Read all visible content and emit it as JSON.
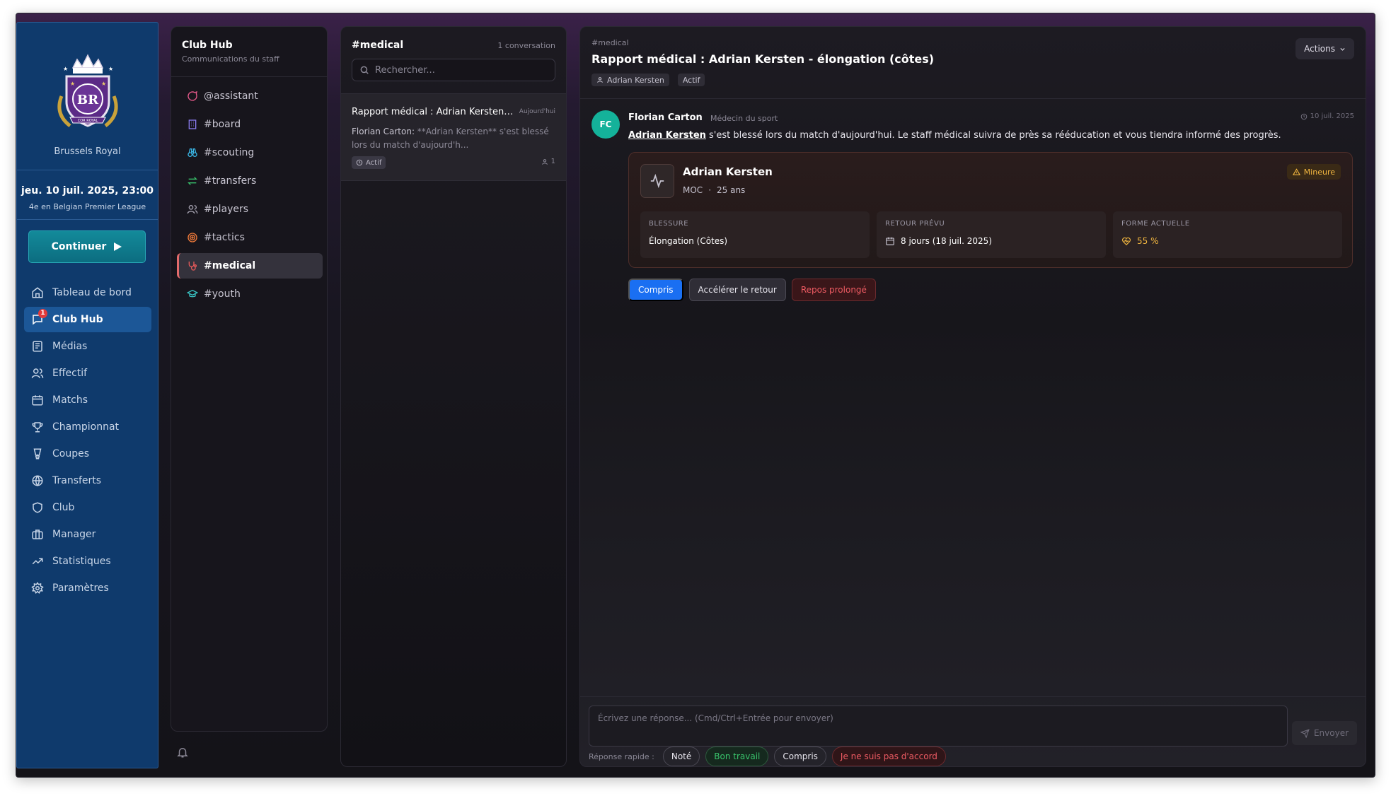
{
  "sidebar": {
    "club_name": "Brussels Royal",
    "crest_text": "BR",
    "crest_banner": "COR ROYAL",
    "date": "jeu. 10 juil. 2025, 23:00",
    "league_position": "4e en Belgian Premier League",
    "continue_label": "Continuer",
    "items": [
      {
        "label": "Tableau de bord",
        "icon": "home-icon"
      },
      {
        "label": "Club Hub",
        "icon": "chat-icon",
        "badge": "1",
        "active": true
      },
      {
        "label": "Médias",
        "icon": "newspaper-icon"
      },
      {
        "label": "Effectif",
        "icon": "users-icon"
      },
      {
        "label": "Matchs",
        "icon": "calendar-icon"
      },
      {
        "label": "Championnat",
        "icon": "trophy-icon"
      },
      {
        "label": "Coupes",
        "icon": "cup-icon"
      },
      {
        "label": "Transferts",
        "icon": "globe-icon"
      },
      {
        "label": "Club",
        "icon": "shield-icon"
      },
      {
        "label": "Manager",
        "icon": "briefcase-icon"
      },
      {
        "label": "Statistiques",
        "icon": "trending-icon"
      },
      {
        "label": "Paramètres",
        "icon": "gear-icon"
      }
    ]
  },
  "channels": {
    "title": "Club Hub",
    "subtitle": "Communications du staff",
    "items": [
      {
        "label": "@assistant",
        "icon": "message-circle-icon",
        "color": "#e85a8c"
      },
      {
        "label": "#board",
        "icon": "building-icon",
        "color": "#8b7cf0"
      },
      {
        "label": "#scouting",
        "icon": "binoculars-icon",
        "color": "#3ab7e6"
      },
      {
        "label": "#transfers",
        "icon": "arrows-swap-icon",
        "color": "#39c46c"
      },
      {
        "label": "#players",
        "icon": "users-icon",
        "color": "#a8a5b3"
      },
      {
        "label": "#tactics",
        "icon": "target-icon",
        "color": "#f07a3a"
      },
      {
        "label": "#medical",
        "icon": "stethoscope-icon",
        "color": "#e85a5a",
        "active": true
      },
      {
        "label": "#youth",
        "icon": "graduation-cap-icon",
        "color": "#39c4c4"
      }
    ]
  },
  "conversations": {
    "channel": "#medical",
    "count": "1 conversation",
    "search_placeholder": "Rechercher...",
    "items": [
      {
        "title": "Rapport médical : Adrian Kersten - élongation (côtes)",
        "time": "Aujourd'hui",
        "preview_sender": "Florian Carton:",
        "preview_text": " **Adrian Kersten** s'est blessé lors du match d'aujourd'h...",
        "status": "Actif",
        "participants": "1"
      }
    ]
  },
  "thread": {
    "channel": "#medical",
    "title": "Rapport médical : Adrian Kersten - élongation (côtes)",
    "tags": [
      "Adrian Kersten",
      "Actif"
    ],
    "actions_label": "Actions",
    "message": {
      "avatar_initials": "FC",
      "sender": "Florian Carton",
      "role": "Médecin du sport",
      "time": "10 juil. 2025",
      "player_link": "Adrian Kersten",
      "text": " s'est blessé lors du match d'aujourd'hui. Le staff médical suivra de près sa rééducation et vous tiendra informé des progrès."
    },
    "injury_card": {
      "player": "Adrian Kersten",
      "position": "MOC",
      "age": "25 ans",
      "separator": "·",
      "severity": "Mineure",
      "stats": [
        {
          "label": "BLESSURE",
          "value": "Élongation (Côtes)"
        },
        {
          "label": "RETOUR PRÉVU",
          "value": "8 jours (18 juil. 2025)"
        },
        {
          "label": "FORME ACTUELLE",
          "value": "55 %"
        }
      ]
    },
    "response_buttons": [
      {
        "label": "Compris",
        "style": "primary"
      },
      {
        "label": "Accélérer le retour",
        "style": "neutral"
      },
      {
        "label": "Repos prolongé",
        "style": "danger"
      }
    ],
    "reply_placeholder": "Écrivez une réponse... (Cmd/Ctrl+Entrée pour envoyer)",
    "send_label": "Envoyer",
    "quick_label": "Réponse rapide :",
    "quick_replies": [
      {
        "label": "Noté",
        "style": "neutral"
      },
      {
        "label": "Bon travail",
        "style": "good"
      },
      {
        "label": "Compris",
        "style": "neutral"
      },
      {
        "label": "Je ne suis pas d'accord",
        "style": "bad"
      }
    ]
  }
}
